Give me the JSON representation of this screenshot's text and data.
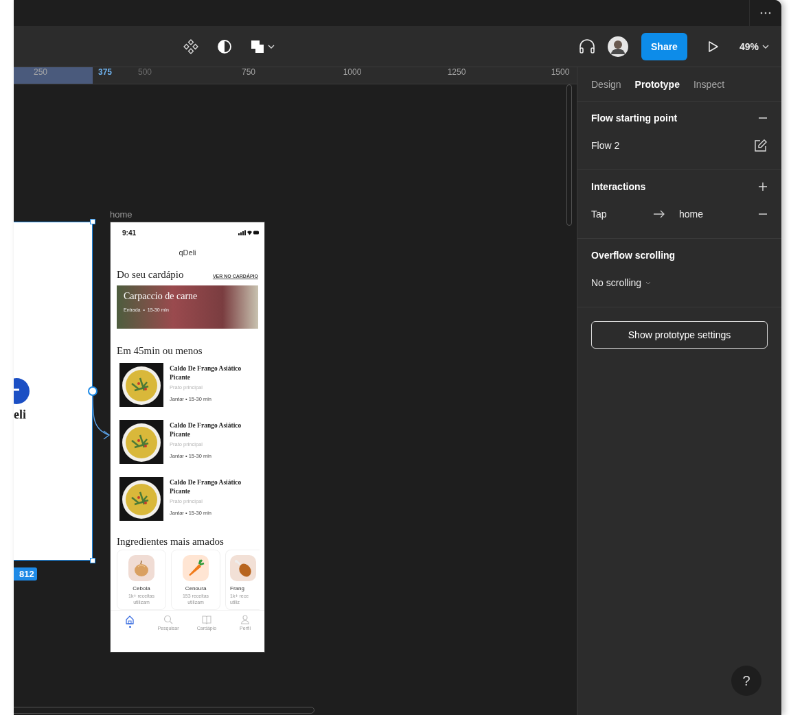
{
  "toolbar": {
    "share_button": "Share",
    "zoom": "49%"
  },
  "ruler": {
    "ticks": [
      {
        "label": "250",
        "kind": "normal"
      },
      {
        "label": "375",
        "kind": "highlight"
      },
      {
        "label": "500",
        "kind": "faded"
      },
      {
        "label": "750",
        "kind": "normal"
      },
      {
        "label": "1000",
        "kind": "normal"
      },
      {
        "label": "1250",
        "kind": "normal"
      },
      {
        "label": "1500",
        "kind": "normal"
      }
    ]
  },
  "canvas": {
    "partial_frame": {
      "text": "eli",
      "size_badge": "812"
    },
    "frame": {
      "name": "home",
      "status_time": "9:41",
      "app_title": "qDeli",
      "menu_section": {
        "title": "Do seu cardápio",
        "link": "VER NO CARDÁPIO"
      },
      "featured": {
        "title": "Carpaccio de carne",
        "meta": "Entrada  •  15-30 min"
      },
      "quick_section": {
        "title": "Em 45min ou menos"
      },
      "recipes": [
        {
          "title": "Caldo De Frango Asiático Picante",
          "category": "Prato principal",
          "meta": "Jantar • 15-30 min"
        },
        {
          "title": "Caldo De Frango Asiático Picante",
          "category": "Prato principal",
          "meta": "Jantar • 15-30 min"
        },
        {
          "title": "Caldo De Frango Asiático Picante",
          "category": "Prato principal",
          "meta": "Jantar • 15-30 min"
        }
      ],
      "ingredients_section": {
        "title": "Ingredientes mais amados"
      },
      "ingredients": [
        {
          "kind": "onion",
          "color": "#f0dcd4",
          "name": "Cebola",
          "count": "1k+ receitas utilizam"
        },
        {
          "kind": "carrot",
          "color": "#ffe5d3",
          "name": "Cenoura",
          "count": "153 receitas utilizam"
        },
        {
          "kind": "drumstick",
          "color": "#f2e0d6",
          "name": "Frang",
          "count": "1k+ rece utiliz"
        }
      ],
      "nav": [
        {
          "kind": "home",
          "selected": true
        },
        {
          "kind": "search",
          "label": "Pesquisar",
          "selected": false
        },
        {
          "kind": "book",
          "label": "Cardápio",
          "selected": false
        },
        {
          "kind": "person",
          "label": "Perfil",
          "selected": false
        }
      ]
    }
  },
  "panel": {
    "tabs": [
      {
        "label": "Design",
        "selected": false
      },
      {
        "label": "Prototype",
        "selected": true
      },
      {
        "label": "Inspect",
        "selected": false
      }
    ],
    "flow": {
      "title": "Flow starting point",
      "name": "Flow 2"
    },
    "interactions": {
      "title": "Interactions",
      "items": [
        {
          "trigger": "Tap",
          "target": "home"
        }
      ]
    },
    "overflow": {
      "title": "Overflow scrolling",
      "value": "No scrolling"
    },
    "settings_button": "Show prototype settings"
  },
  "help_button": "?"
}
